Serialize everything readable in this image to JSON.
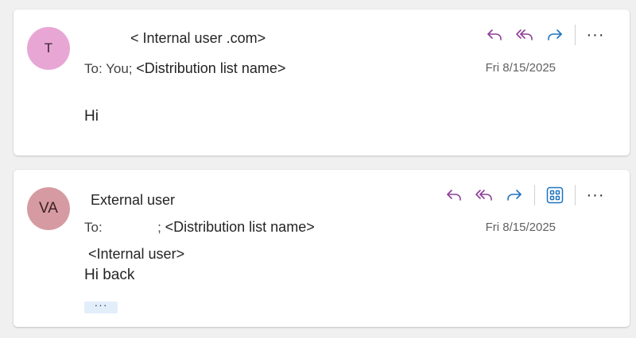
{
  "colors": {
    "reply_purple": "#8f3e97",
    "forward_blue": "#1e73be",
    "avatar_t": "#e8a6d5",
    "avatar_va": "#d69ba2"
  },
  "messages": [
    {
      "avatar_initials": "T",
      "sender": "<  Internal user                     .com>",
      "to_label": "To:",
      "to_recipients": "You;",
      "to_distribution": "<Distribution list name>",
      "date": "Fri 8/15/2025",
      "body": "Hi",
      "actions": [
        "reply-icon",
        "reply-all-icon",
        "forward-icon",
        "more-icon"
      ]
    },
    {
      "avatar_initials": "VA",
      "sender": "External user",
      "to_label": "To:",
      "to_recipients": ";",
      "to_distribution": "<Distribution list name>",
      "date": "Fri 8/15/2025",
      "quote": "<Internal user>",
      "body": "Hi back",
      "expand_label": "···",
      "actions": [
        "reply-icon",
        "reply-all-icon",
        "forward-icon",
        "apps-icon",
        "more-icon"
      ]
    }
  ],
  "more_label": "···"
}
